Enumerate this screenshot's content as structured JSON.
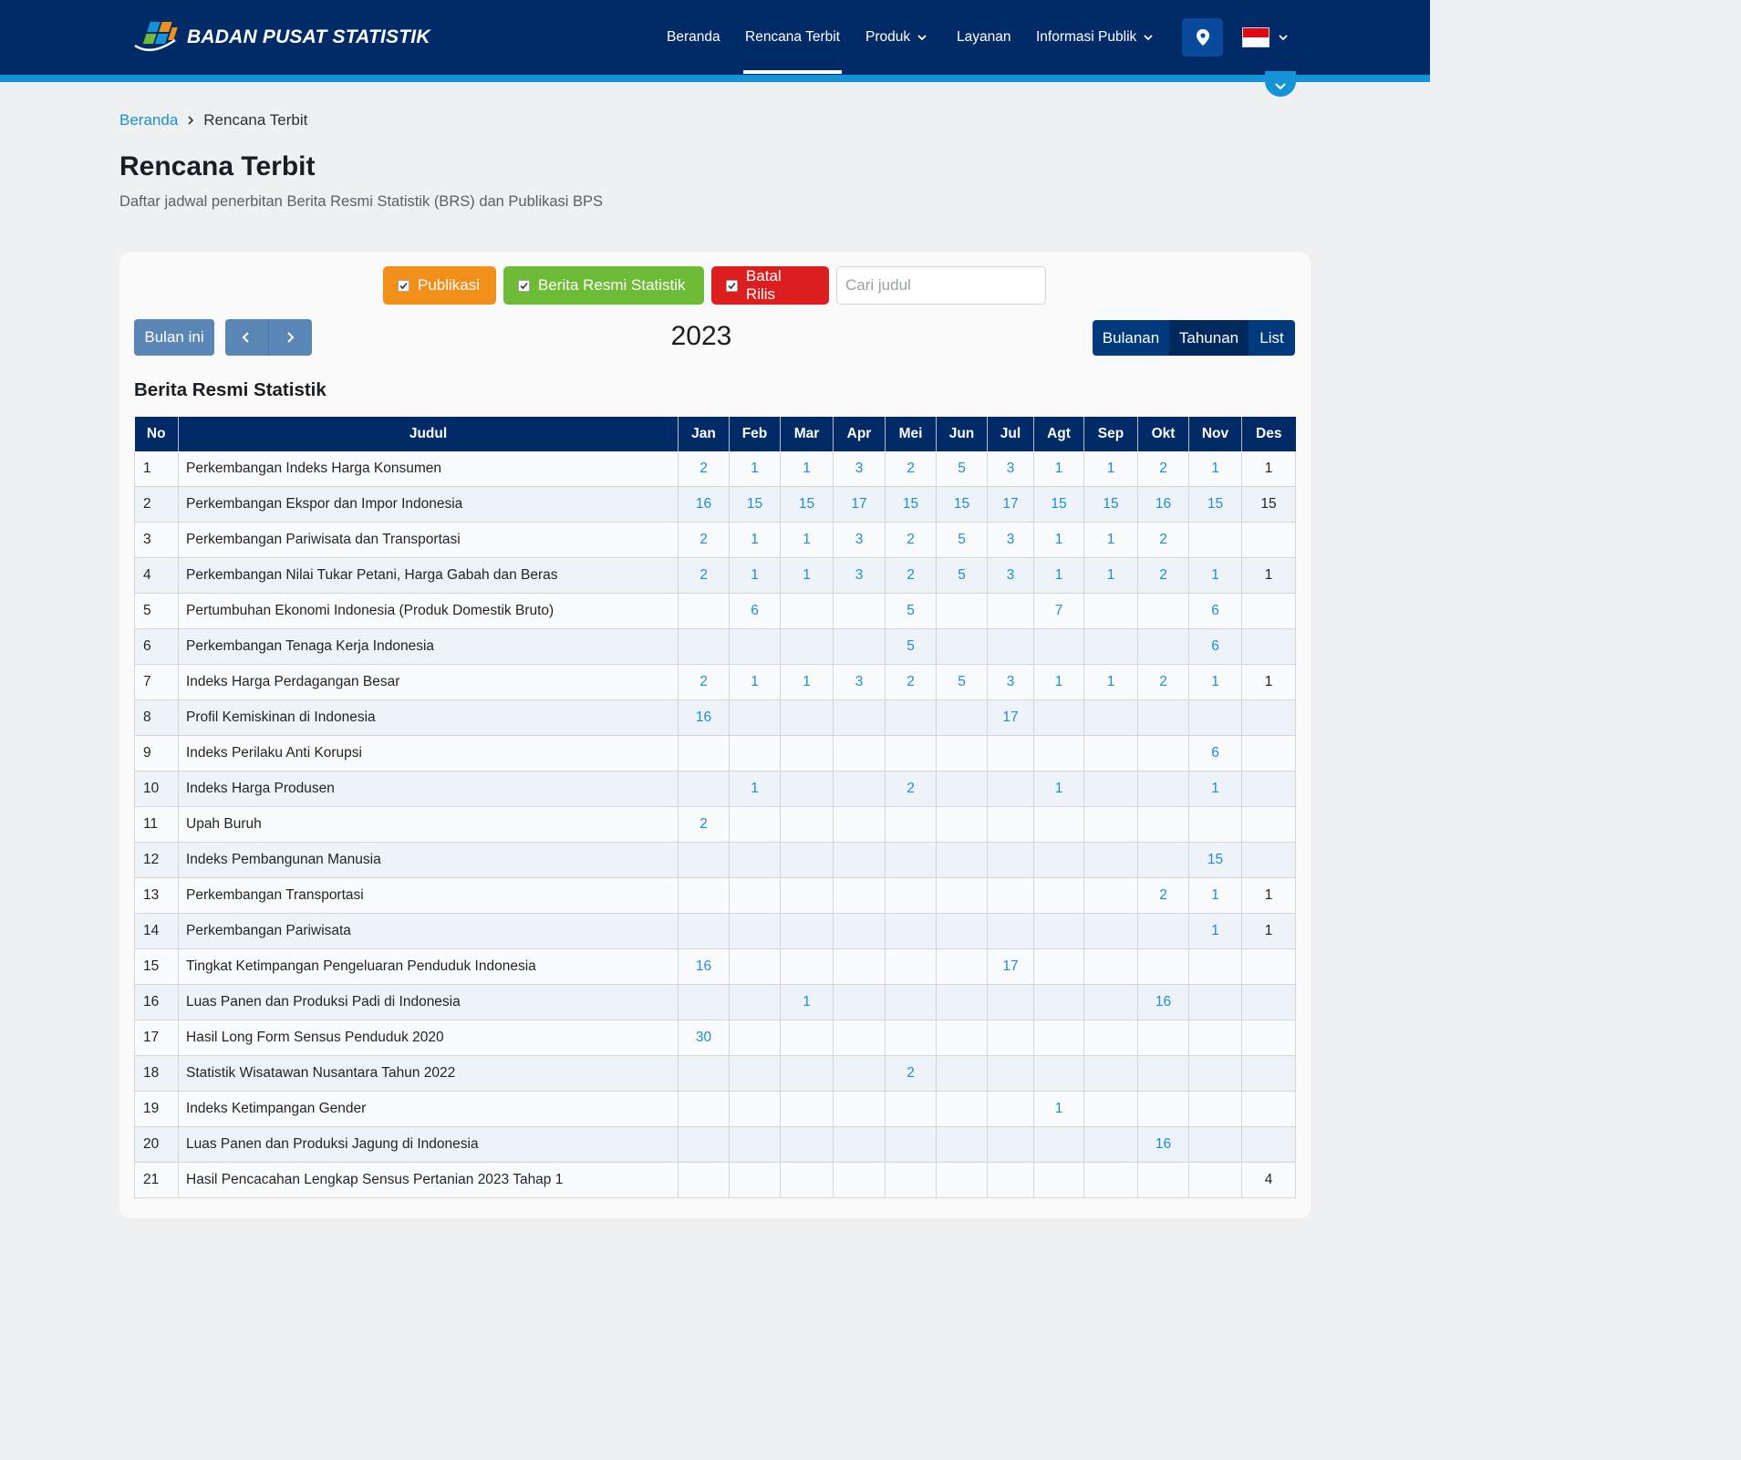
{
  "header": {
    "brand_name": "BADAN PUSAT STATISTIK",
    "nav": [
      {
        "label": "Beranda"
      },
      {
        "label": "Rencana Terbit"
      },
      {
        "label": "Produk"
      },
      {
        "label": "Layanan"
      },
      {
        "label": "Informasi Publik"
      }
    ],
    "active_nav": "Rencana Terbit"
  },
  "breadcrumb": {
    "home": "Beranda",
    "current": "Rencana Terbit"
  },
  "page": {
    "title": "Rencana Terbit",
    "subtitle": "Daftar jadwal penerbitan Berita Resmi Statistik (BRS) dan Publikasi BPS"
  },
  "filters": {
    "publikasi": "Publikasi",
    "brs": "Berita Resmi Statistik",
    "batal": "Batal Rilis",
    "search_placeholder": "Cari judul",
    "colors": {
      "publikasi": "#f0901a",
      "brs": "#6dbb37",
      "batal": "#dc1e1e"
    }
  },
  "toolbar": {
    "today": "Bulan ini",
    "year": "2023",
    "views": [
      "Bulanan",
      "Tahunan",
      "List"
    ],
    "active_view": "Tahunan"
  },
  "section_title": "Berita Resmi Statistik",
  "table": {
    "headers": [
      "No",
      "Judul",
      "Jan",
      "Feb",
      "Mar",
      "Apr",
      "Mei",
      "Jun",
      "Jul",
      "Agt",
      "Sep",
      "Okt",
      "Nov",
      "Des"
    ],
    "rows": [
      [
        "1",
        "Perkembangan Indeks Harga Konsumen",
        "2",
        "1",
        "1",
        "3",
        "2",
        "5",
        "3",
        "1",
        "1",
        "2",
        "1",
        "1"
      ],
      [
        "2",
        "Perkembangan Ekspor dan Impor Indonesia",
        "16",
        "15",
        "15",
        "17",
        "15",
        "15",
        "17",
        "15",
        "15",
        "16",
        "15",
        "15"
      ],
      [
        "3",
        "Perkembangan Pariwisata dan Transportasi",
        "2",
        "1",
        "1",
        "3",
        "2",
        "5",
        "3",
        "1",
        "1",
        "2",
        "",
        ""
      ],
      [
        "4",
        "Perkembangan Nilai Tukar Petani, Harga Gabah dan Beras",
        "2",
        "1",
        "1",
        "3",
        "2",
        "5",
        "3",
        "1",
        "1",
        "2",
        "1",
        "1"
      ],
      [
        "5",
        "Pertumbuhan Ekonomi Indonesia (Produk Domestik Bruto)",
        "",
        "6",
        "",
        "",
        "5",
        "",
        "",
        "7",
        "",
        "",
        "6",
        ""
      ],
      [
        "6",
        "Perkembangan Tenaga Kerja Indonesia",
        "",
        "",
        "",
        "",
        "5",
        "",
        "",
        "",
        "",
        "",
        "6",
        ""
      ],
      [
        "7",
        "Indeks Harga Perdagangan Besar",
        "2",
        "1",
        "1",
        "3",
        "2",
        "5",
        "3",
        "1",
        "1",
        "2",
        "1",
        "1"
      ],
      [
        "8",
        "Profil Kemiskinan di Indonesia",
        "16",
        "",
        "",
        "",
        "",
        "",
        "17",
        "",
        "",
        "",
        "",
        ""
      ],
      [
        "9",
        "Indeks Perilaku Anti Korupsi",
        "",
        "",
        "",
        "",
        "",
        "",
        "",
        "",
        "",
        "",
        "6",
        ""
      ],
      [
        "10",
        "Indeks Harga Produsen",
        "",
        "1",
        "",
        "",
        "2",
        "",
        "",
        "1",
        "",
        "",
        "1",
        ""
      ],
      [
        "11",
        "Upah Buruh",
        "2",
        "",
        "",
        "",
        "",
        "",
        "",
        "",
        "",
        "",
        "",
        ""
      ],
      [
        "12",
        "Indeks Pembangunan Manusia",
        "",
        "",
        "",
        "",
        "",
        "",
        "",
        "",
        "",
        "",
        "15",
        ""
      ],
      [
        "13",
        "Perkembangan Transportasi",
        "",
        "",
        "",
        "",
        "",
        "",
        "",
        "",
        "",
        "2",
        "1",
        "1"
      ],
      [
        "14",
        "Perkembangan Pariwisata",
        "",
        "",
        "",
        "",
        "",
        "",
        "",
        "",
        "",
        "",
        "1",
        "1"
      ],
      [
        "15",
        "Tingkat Ketimpangan Pengeluaran Penduduk Indonesia",
        "16",
        "",
        "",
        "",
        "",
        "",
        "17",
        "",
        "",
        "",
        "",
        ""
      ],
      [
        "16",
        "Luas Panen dan Produksi Padi di Indonesia",
        "",
        "",
        "1",
        "",
        "",
        "",
        "",
        "",
        "",
        "16",
        "",
        ""
      ],
      [
        "17",
        "Hasil Long Form Sensus Penduduk 2020",
        "30",
        "",
        "",
        "",
        "",
        "",
        "",
        "",
        "",
        "",
        "",
        ""
      ],
      [
        "18",
        "Statistik Wisatawan Nusantara Tahun 2022",
        "",
        "",
        "",
        "",
        "2",
        "",
        "",
        "",
        "",
        "",
        "",
        ""
      ],
      [
        "19",
        "Indeks Ketimpangan Gender",
        "",
        "",
        "",
        "",
        "",
        "",
        "",
        "1",
        "",
        "",
        "",
        ""
      ],
      [
        "20",
        "Luas Panen dan Produksi Jagung di Indonesia",
        "",
        "",
        "",
        "",
        "",
        "",
        "",
        "",
        "",
        "16",
        "",
        ""
      ],
      [
        "21",
        "Hasil Pencacahan Lengkap Sensus Pertanian 2023 Tahap 1",
        "",
        "",
        "",
        "",
        "",
        "",
        "",
        "",
        "",
        "",
        "",
        "4"
      ]
    ]
  },
  "icons": {
    "logo": "bps-logo",
    "location": "map-pin-icon",
    "language": "indonesia-flag-icon",
    "chevron": "chevron-down-icon"
  }
}
